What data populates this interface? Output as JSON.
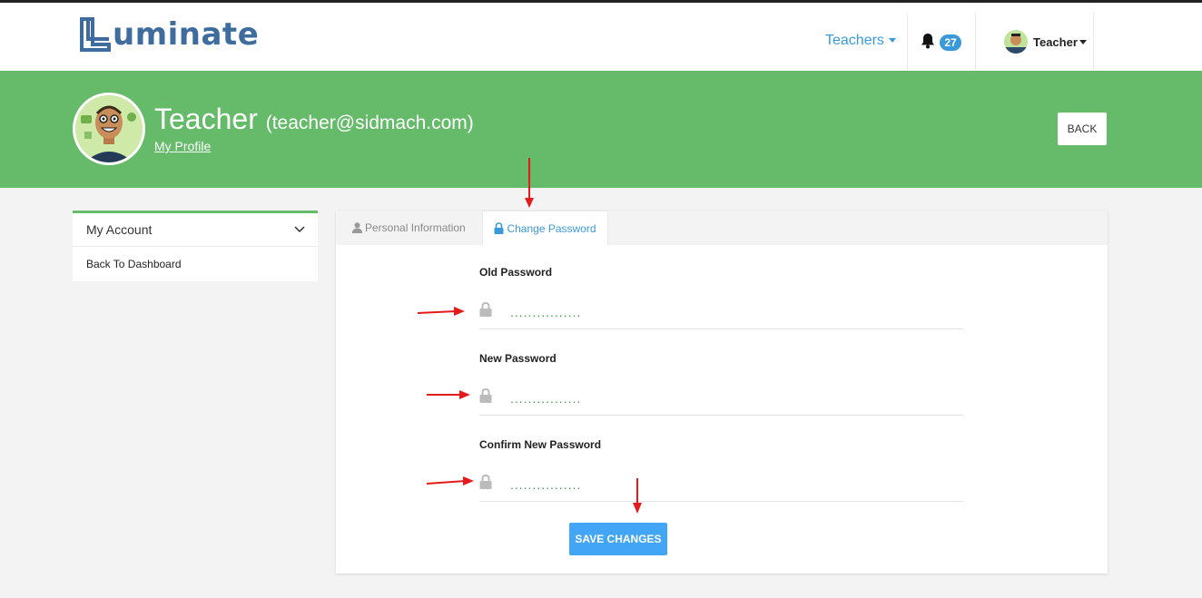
{
  "brand": {
    "name": "uminate"
  },
  "nav": {
    "teachers_label": "Teachers",
    "notification_count": "27",
    "user_label": "Teacher"
  },
  "profile": {
    "name": "Teacher",
    "email": "(teacher@sidmach.com)",
    "my_profile_label": "My Profile",
    "back_label": "BACK"
  },
  "sidebar": {
    "heading": "My Account",
    "items": [
      {
        "label": "Back To Dashboard"
      }
    ]
  },
  "tabs": [
    {
      "label": "Personal Information",
      "icon": "user-icon",
      "active": false
    },
    {
      "label": "Change Password",
      "icon": "lock-icon",
      "active": true
    }
  ],
  "form": {
    "old_password": {
      "label": "Old Password",
      "value": "................"
    },
    "new_password": {
      "label": "New Password",
      "value": "................"
    },
    "confirm_password": {
      "label": "Confirm New Password",
      "value": "................"
    },
    "submit_label": "SAVE CHANGES"
  },
  "colors": {
    "brand_green": "#66bb6a",
    "accent_blue": "#3a9ad9",
    "button_blue": "#42a5f5",
    "logo_blue": "#3e6c9e",
    "annotation_red": "#e31b1b"
  }
}
